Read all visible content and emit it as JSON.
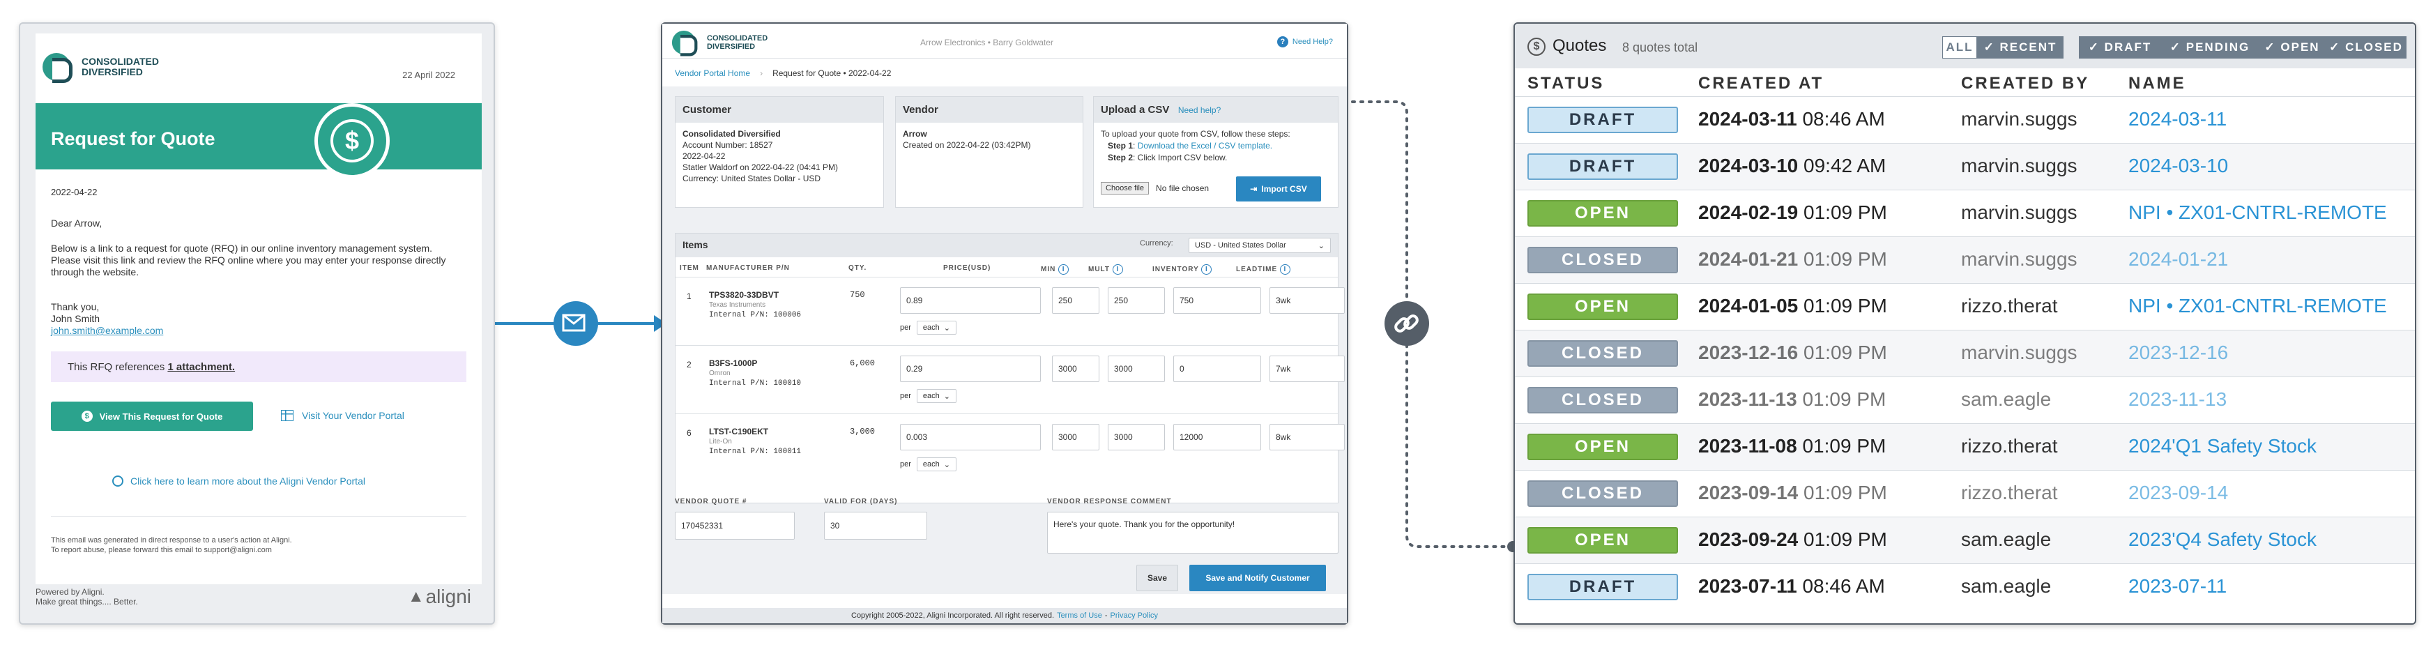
{
  "email": {
    "logo_line1": "CONSOLIDATED",
    "logo_line2": "DIVERSIFIED",
    "date": "22 April 2022",
    "banner_title": "Request for Quote",
    "rfq_date": "2022-04-22",
    "greeting": "Dear Arrow,",
    "body": "Below is a link to a request for quote (RFQ) in our online inventory management system. Please visit this link and review the RFQ online where you may enter your response directly through the website.",
    "thanks": "Thank you,",
    "signer": "John Smith",
    "signer_email": "john.smith@example.com",
    "attach_prefix": "This RFQ references ",
    "attach_link": "1 attachment.",
    "view_button": "View This Request for Quote",
    "portal_link": "Visit Your Vendor Portal",
    "learn_link": "Click here to learn more about the Aligni Vendor Portal",
    "footer1": "This email was generated in direct response to a user's action at Aligni.",
    "footer2": "To report abuse, please forward this email to support@aligni.com",
    "powered1": "Powered by Aligni.",
    "powered2": "Make great things.... Better.",
    "brand": "aligni"
  },
  "portal": {
    "logo_line1": "CONSOLIDATED",
    "logo_line2": "DIVERSIFIED",
    "user": "Arrow Electronics • Barry Goldwater",
    "help": "Need Help?",
    "crumb_home": "Vendor Portal Home",
    "crumb_current": "Request for Quote • 2022-04-22",
    "customer": {
      "title": "Customer",
      "name": "Consolidated Diversified",
      "account": "Account Number: 18527",
      "date": "2022-04-22",
      "location": "Statler Waldorf on 2022-04-22 (04:41 PM)",
      "currency": "Currency: United States Dollar - USD"
    },
    "vendor": {
      "title": "Vendor",
      "name": "Arrow",
      "created": "Created on 2022-04-22 (03:42PM)"
    },
    "upload": {
      "title": "Upload a CSV",
      "help": "Need help?",
      "intro": "To upload your quote from CSV, follow these steps:",
      "step1_label": "Step 1",
      "step1_link": "Download the Excel / CSV template.",
      "step2_label": "Step 2",
      "step2_text": ": Click Import CSV below.",
      "choose": "Choose file",
      "nofile": "No file chosen",
      "import": "Import CSV"
    },
    "items": {
      "title": "Items",
      "currency_label": "Currency:",
      "currency_value": "USD - United States Dollar",
      "headers": [
        "ITEM",
        "MANUFACTURER P/N",
        "QTY.",
        "PRICE(USD)",
        "MIN",
        "MULT",
        "INVENTORY",
        "LEADTIME"
      ],
      "per_label": "per",
      "rows": [
        {
          "item": "1",
          "pn": "TPS3820-33DBVT",
          "mfr": "Texas Instruments",
          "internal": "Internal P/N: 100006",
          "qty": "750",
          "price": "0.89",
          "per": "each",
          "min": "250",
          "mult": "250",
          "inventory": "750",
          "leadtime": "3wk"
        },
        {
          "item": "2",
          "pn": "B3FS-1000P",
          "mfr": "Omron",
          "internal": "Internal P/N: 100010",
          "qty": "6,000",
          "price": "0.29",
          "per": "each",
          "min": "3000",
          "mult": "3000",
          "inventory": "0",
          "leadtime": "7wk"
        },
        {
          "item": "6",
          "pn": "LTST-C190EKT",
          "mfr": "Lite-On",
          "internal": "Internal P/N: 100011",
          "qty": "3,000",
          "price": "0.003",
          "per": "each",
          "min": "3000",
          "mult": "3000",
          "inventory": "12000",
          "leadtime": "8wk"
        }
      ]
    },
    "vq_label": "VENDOR QUOTE #",
    "vq_value": "170452331",
    "valid_label": "VALID FOR (DAYS)",
    "valid_value": "30",
    "comment_label": "VENDOR RESPONSE COMMENT",
    "comment_value": "Here's your quote.  Thank you for the opportunity!",
    "save": "Save",
    "save_notify": "Save and Notify Customer",
    "copyright": "Copyright 2005-2022, Aligni Incorporated. All right reserved.",
    "terms": "Terms of Use",
    "privacy": "Privacy Policy"
  },
  "quotes": {
    "title": "Quotes",
    "count": "8 quotes total",
    "filters": [
      "ALL",
      "RECENT",
      "DRAFT",
      "PENDING",
      "OPEN",
      "CLOSED"
    ],
    "headers": [
      "STATUS",
      "CREATED AT",
      "CREATED BY",
      "NAME"
    ],
    "rows": [
      {
        "status": "DRAFT",
        "date": "2024-03-11",
        "time": "08:46 AM",
        "by": "marvin.suggs",
        "name": "2024-03-11"
      },
      {
        "status": "DRAFT",
        "date": "2024-03-10",
        "time": "09:42 AM",
        "by": "marvin.suggs",
        "name": "2024-03-10"
      },
      {
        "status": "OPEN",
        "date": "2024-02-19",
        "time": "01:09 PM",
        "by": "marvin.suggs",
        "name": "NPI • ZX01-CNTRL-REMOTE"
      },
      {
        "status": "CLOSED",
        "date": "2024-01-21",
        "time": "01:09 PM",
        "by": "marvin.suggs",
        "name": "2024-01-21"
      },
      {
        "status": "OPEN",
        "date": "2024-01-05",
        "time": "01:09 PM",
        "by": "rizzo.therat",
        "name": "NPI • ZX01-CNTRL-REMOTE"
      },
      {
        "status": "CLOSED",
        "date": "2023-12-16",
        "time": "01:09 PM",
        "by": "marvin.suggs",
        "name": "2023-12-16"
      },
      {
        "status": "CLOSED",
        "date": "2023-11-13",
        "time": "01:09 PM",
        "by": "sam.eagle",
        "name": "2023-11-13"
      },
      {
        "status": "OPEN",
        "date": "2023-11-08",
        "time": "01:09 PM",
        "by": "rizzo.therat",
        "name": "2024'Q1 Safety Stock"
      },
      {
        "status": "CLOSED",
        "date": "2023-09-14",
        "time": "01:09 PM",
        "by": "rizzo.therat",
        "name": "2023-09-14"
      },
      {
        "status": "OPEN",
        "date": "2023-09-24",
        "time": "01:09 PM",
        "by": "sam.eagle",
        "name": "2023'Q4 Safety Stock"
      },
      {
        "status": "DRAFT",
        "date": "2023-07-11",
        "time": "08:46 AM",
        "by": "sam.eagle",
        "name": "2023-07-11"
      }
    ]
  },
  "colors": {
    "teal": "#2ba38d",
    "link": "#2a93d5",
    "open": "#7ab648",
    "closed": "#97a6b6",
    "draft": "#cfe6f5",
    "connector": "#2a87c1"
  }
}
